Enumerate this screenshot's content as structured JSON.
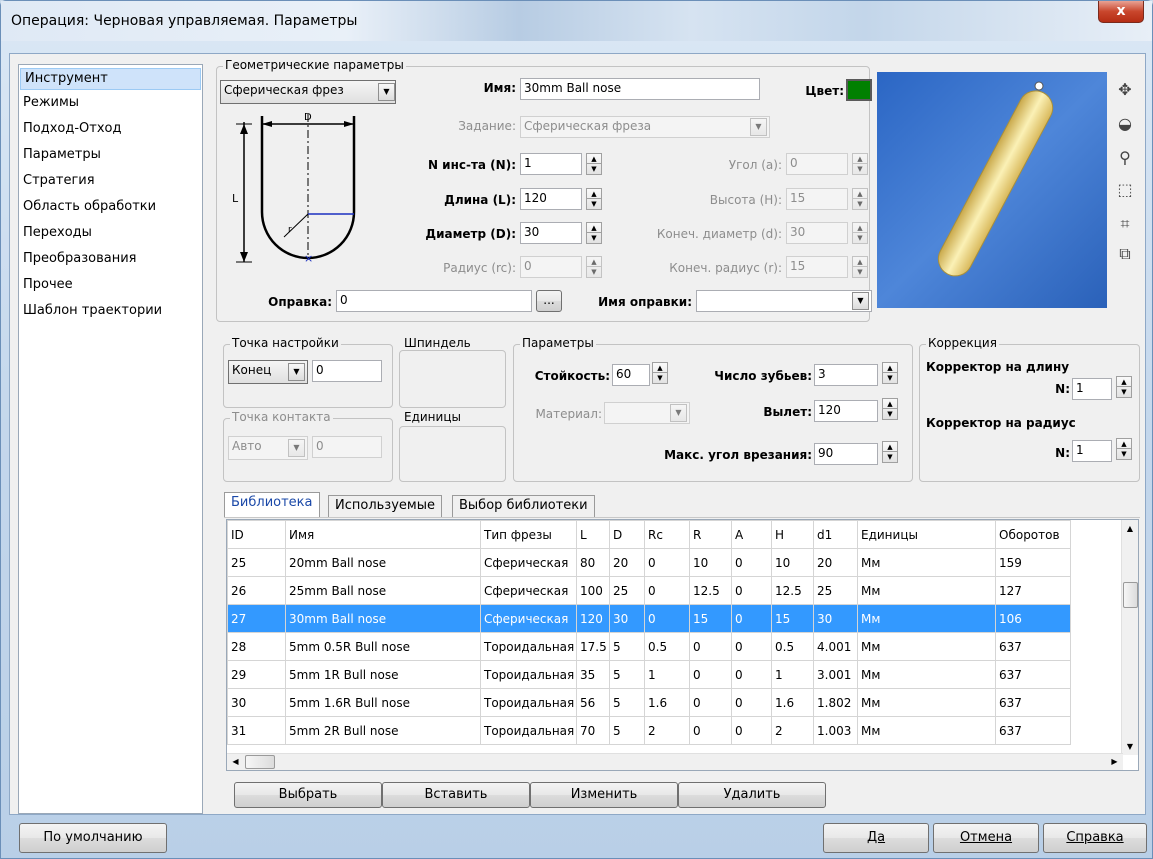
{
  "window": {
    "title": "Операция: Черновая управляемая. Параметры",
    "close_label": "x"
  },
  "nav": {
    "items": [
      {
        "label": "Инструмент",
        "selected": true
      },
      {
        "label": "Режимы"
      },
      {
        "label": "Подход-Отход"
      },
      {
        "label": "Параметры"
      },
      {
        "label": "Стратегия"
      },
      {
        "label": "Область обработки"
      },
      {
        "label": "Переходы"
      },
      {
        "label": "Преобразования"
      },
      {
        "label": "Прочее"
      },
      {
        "label": "Шаблон траектории"
      }
    ]
  },
  "geometry": {
    "group_label": "Геометрические параметры",
    "tool_type_value": "Сферическая фрез",
    "diagram_labels": {
      "d_top": "D",
      "l_side": "L",
      "rc": "r"
    },
    "name_label": "Имя:",
    "name_value": "30mm Ball nose",
    "color_label": "Цвет:",
    "color_value": "#008000",
    "task_label": "Задание:",
    "task_value": "Сферическая фреза",
    "n_label": "N инс-та (N):",
    "n_value": "1",
    "length_label": "Длина (L):",
    "length_value": "120",
    "diameter_label": "Диаметр (D):",
    "diameter_value": "30",
    "radius_label": "Радиус (rc):",
    "radius_value": "0",
    "angle_label": "Угол (a):",
    "angle_value": "0",
    "height_label": "Высота (H):",
    "height_value": "15",
    "end_diam_label": "Конеч. диаметр (d):",
    "end_diam_value": "30",
    "end_rad_label": "Конеч. радиус (r):",
    "end_rad_value": "15",
    "holder_label": "Оправка:",
    "holder_value": "0",
    "holder_browse": "...",
    "holder_name_label": "Имя оправки:",
    "holder_name_value": ""
  },
  "setup_point": {
    "label": "Точка настройки",
    "value": "Конец",
    "num": "0"
  },
  "contact_point": {
    "label": "Точка контакта",
    "value": "Авто",
    "num": "0"
  },
  "spindle_label": "Шпиндель",
  "units_label": "Единицы",
  "params": {
    "group_label": "Параметры",
    "durability_label": "Стойкость:",
    "durability_value": "60",
    "teeth_label": "Число зубьев:",
    "teeth_value": "3",
    "material_label": "Материал:",
    "material_value": "",
    "overhang_label": "Вылет:",
    "overhang_value": "120",
    "max_angle_label": "Макс. угол врезания:",
    "max_angle_value": "90"
  },
  "correction": {
    "group_label": "Коррекция",
    "length_label": "Корректор на длину",
    "length_n_label": "N:",
    "length_n_value": "1",
    "radius_label": "Корректор на радиус",
    "radius_n_label": "N:",
    "radius_n_value": "1"
  },
  "tabs": [
    {
      "label": "Библиотека",
      "selected": true
    },
    {
      "label": "Используемые"
    },
    {
      "label": "Выбор библиотеки"
    }
  ],
  "table": {
    "columns": [
      "ID",
      "Имя",
      "Тип фрезы",
      "L",
      "D",
      "Rc",
      "R",
      "A",
      "H",
      "d1",
      "Единицы",
      "Оборотов"
    ],
    "rows": [
      [
        "25",
        "20mm Ball nose",
        "Сферическая",
        "80",
        "20",
        "0",
        "10",
        "0",
        "10",
        "20",
        "Мм",
        "159"
      ],
      [
        "26",
        "25mm Ball nose",
        "Сферическая",
        "100",
        "25",
        "0",
        "12.5",
        "0",
        "12.5",
        "25",
        "Мм",
        "127"
      ],
      [
        "27",
        "30mm Ball nose",
        "Сферическая",
        "120",
        "30",
        "0",
        "15",
        "0",
        "15",
        "30",
        "Мм",
        "106"
      ],
      [
        "28",
        "5mm 0.5R Bull nose",
        "Тороидальная",
        "17.5",
        "5",
        "0.5",
        "0",
        "0",
        "0.5",
        "4.001",
        "Мм",
        "637"
      ],
      [
        "29",
        "5mm 1R Bull nose",
        "Тороидальная",
        "35",
        "5",
        "1",
        "0",
        "0",
        "1",
        "3.001",
        "Мм",
        "637"
      ],
      [
        "30",
        "5mm 1.6R Bull nose",
        "Тороидальная",
        "56",
        "5",
        "1.6",
        "0",
        "0",
        "1.6",
        "1.802",
        "Мм",
        "637"
      ],
      [
        "31",
        "5mm 2R Bull nose",
        "Тороидальная",
        "70",
        "5",
        "2",
        "0",
        "0",
        "2",
        "1.003",
        "Мм",
        "637"
      ]
    ],
    "selected_row": 2
  },
  "actions": {
    "select": "Выбрать",
    "insert": "Вставить",
    "edit": "Изменить",
    "delete": "Удалить"
  },
  "footer": {
    "default": "По умолчанию",
    "ok": "Да",
    "cancel": "Отмена",
    "help": "Справка"
  },
  "icons": [
    "pan-icon",
    "rotate-icon",
    "zoom-icon",
    "zoom-window-icon",
    "fit-icon",
    "view-cube-icon"
  ]
}
